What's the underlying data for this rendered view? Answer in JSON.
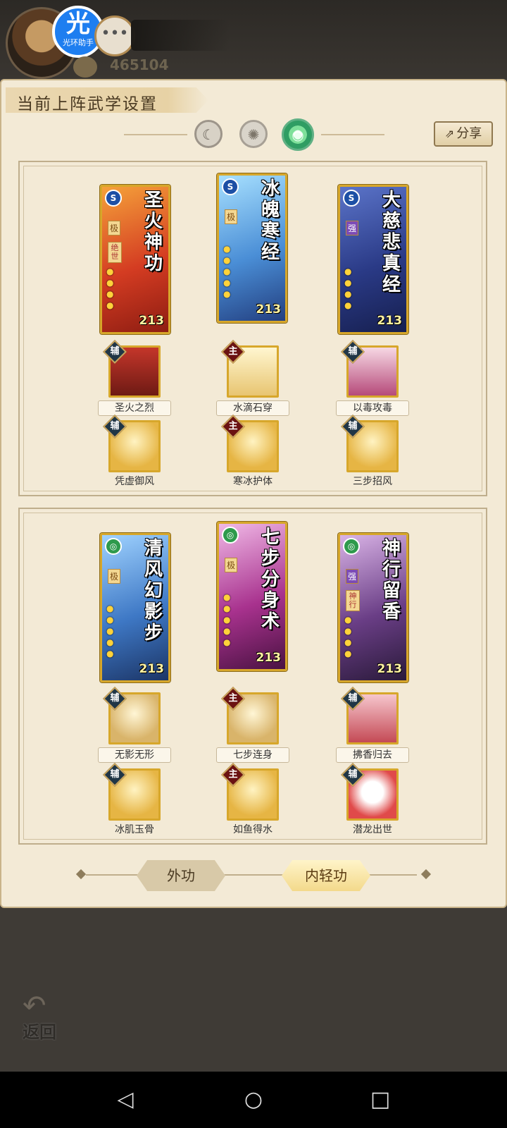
{
  "player": {
    "power": "465104",
    "badge_big": "光",
    "badge_small": "光环助手"
  },
  "panel": {
    "title": "当前上阵武学设置",
    "share_label": "分享"
  },
  "groups": [
    {
      "cards": [
        {
          "title": "圣火神功",
          "badge": "S",
          "tag": "极",
          "tag2": "绝世",
          "level": "213"
        },
        {
          "title": "冰魄寒经",
          "badge": "S",
          "tag": "极",
          "level": "213"
        },
        {
          "title": "大慈悲真经",
          "badge": "S",
          "tag": "强",
          "level": "213"
        }
      ],
      "skills_row1": [
        {
          "role": "辅",
          "label": "圣火之烈"
        },
        {
          "role": "主",
          "label": "水滴石穿"
        },
        {
          "role": "辅",
          "label": "以毒攻毒"
        }
      ],
      "skills_row2": [
        {
          "role": "辅",
          "label": "凭虚御风"
        },
        {
          "role": "主",
          "label": "寒冰护体"
        },
        {
          "role": "辅",
          "label": "三步招风"
        }
      ]
    },
    {
      "cards": [
        {
          "title": "清风幻影步",
          "tag": "极",
          "level": "213"
        },
        {
          "title": "七步分身术",
          "tag": "极",
          "level": "213"
        },
        {
          "title": "神行留香",
          "tag": "强",
          "tag2": "神行",
          "level": "213"
        }
      ],
      "skills_row1": [
        {
          "role": "辅",
          "label": "无影无形"
        },
        {
          "role": "主",
          "label": "七步连身"
        },
        {
          "role": "辅",
          "label": "拂香归去"
        }
      ],
      "skills_row2": [
        {
          "role": "辅",
          "label": "冰肌玉骨"
        },
        {
          "role": "主",
          "label": "如鱼得水"
        },
        {
          "role": "辅",
          "label": "潜龙出世"
        }
      ]
    }
  ],
  "tabs": {
    "outer": "外功",
    "inner": "内轻功",
    "active": "内轻功"
  },
  "back_label": "返回",
  "colors": {
    "panel_bg": "#f3ead6",
    "card_border": "#d7a72b",
    "aux_role": "#203646",
    "main_role": "#6b1212"
  }
}
